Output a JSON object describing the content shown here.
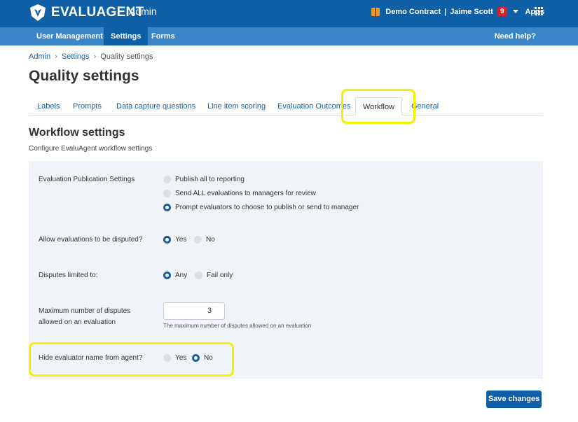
{
  "header": {
    "brand": "EVALUAGENT",
    "section": "Admin",
    "contract": "Demo Contract",
    "separator": "|",
    "user": "Jaime Scott",
    "notifications": "9",
    "apps": "Apps",
    "icons": [
      "logo-icon",
      "gift-icon",
      "caret-down-icon",
      "apps-grid-icon"
    ]
  },
  "subnav": {
    "items": [
      "User Management",
      "Settings",
      "Forms"
    ],
    "active": "Settings",
    "help": "Need help?"
  },
  "breadcrumb": [
    "Admin",
    "Settings",
    "Quality settings"
  ],
  "page_title": "Quality settings",
  "tabs": [
    "Labels",
    "Prompts",
    "Data capture questions",
    "Line item scoring",
    "Evaluation Outcomes",
    "Workflow",
    "General"
  ],
  "active_tab": "Workflow",
  "section": {
    "title": "Workflow settings",
    "subtitle": "Configure EvaluAgent workflow settings"
  },
  "settings": {
    "publication": {
      "label": "Evaluation Publication Settings",
      "options": [
        "Publish all to reporting",
        "Send ALL evaluations to managers for review",
        "Prompt evaluators to choose to publish or send to manager"
      ],
      "selected": 2
    },
    "disputes_allowed": {
      "label": "Allow evaluations to be disputed?",
      "options": [
        "Yes",
        "No"
      ],
      "selected": 0
    },
    "disputes_limited": {
      "label": "Disputes limited to:",
      "options": [
        "Any",
        "Fail only"
      ],
      "selected": 0
    },
    "max_disputes": {
      "label_line1": "Maximum number of disputes",
      "label_line2": "allowed on an evaluation",
      "value": "3",
      "help": "The maximum number of disputes allowed on an evaluation"
    },
    "hide_evaluator": {
      "label": "Hide evaluator name from agent?",
      "options": [
        "Yes",
        "No"
      ],
      "selected": 1
    }
  },
  "save_label": "Save changes",
  "highlight_color": "#f5f000",
  "brand_color": "#0f5fa6"
}
